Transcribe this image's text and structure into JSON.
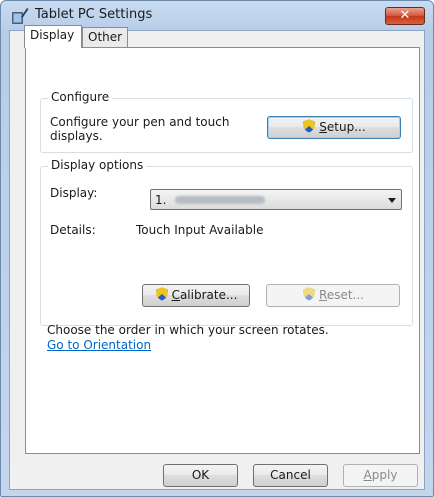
{
  "window": {
    "title": "Tablet PC Settings",
    "close_label": "✕"
  },
  "tabs": [
    {
      "label": "Display"
    },
    {
      "label": "Other"
    }
  ],
  "configure": {
    "group_label": "Configure",
    "description": "Configure your pen and touch displays.",
    "setup_button": {
      "pre": "",
      "accel": "S",
      "post": "etup..."
    }
  },
  "display_options": {
    "group_label": "Display options",
    "display_label": "Display:",
    "display_value": "1.",
    "details_label": "Details:",
    "details_value": "Touch Input Available",
    "calibrate_button": {
      "accel": "C",
      "post": "alibrate..."
    },
    "reset_button": {
      "accel": "R",
      "post": "eset..."
    }
  },
  "orientation": {
    "text": "Choose the order in which your screen rotates.",
    "link": "Go to Orientation"
  },
  "footer": {
    "ok": "OK",
    "cancel": "Cancel",
    "apply": {
      "accel": "A",
      "post": "pply"
    }
  },
  "colors": {
    "link": "#0066cc",
    "close_button": "#c23818",
    "panel_border": "#898c95"
  },
  "icons": {
    "window": "tablet-pen-icon",
    "shield": "uac-shield-icon"
  }
}
